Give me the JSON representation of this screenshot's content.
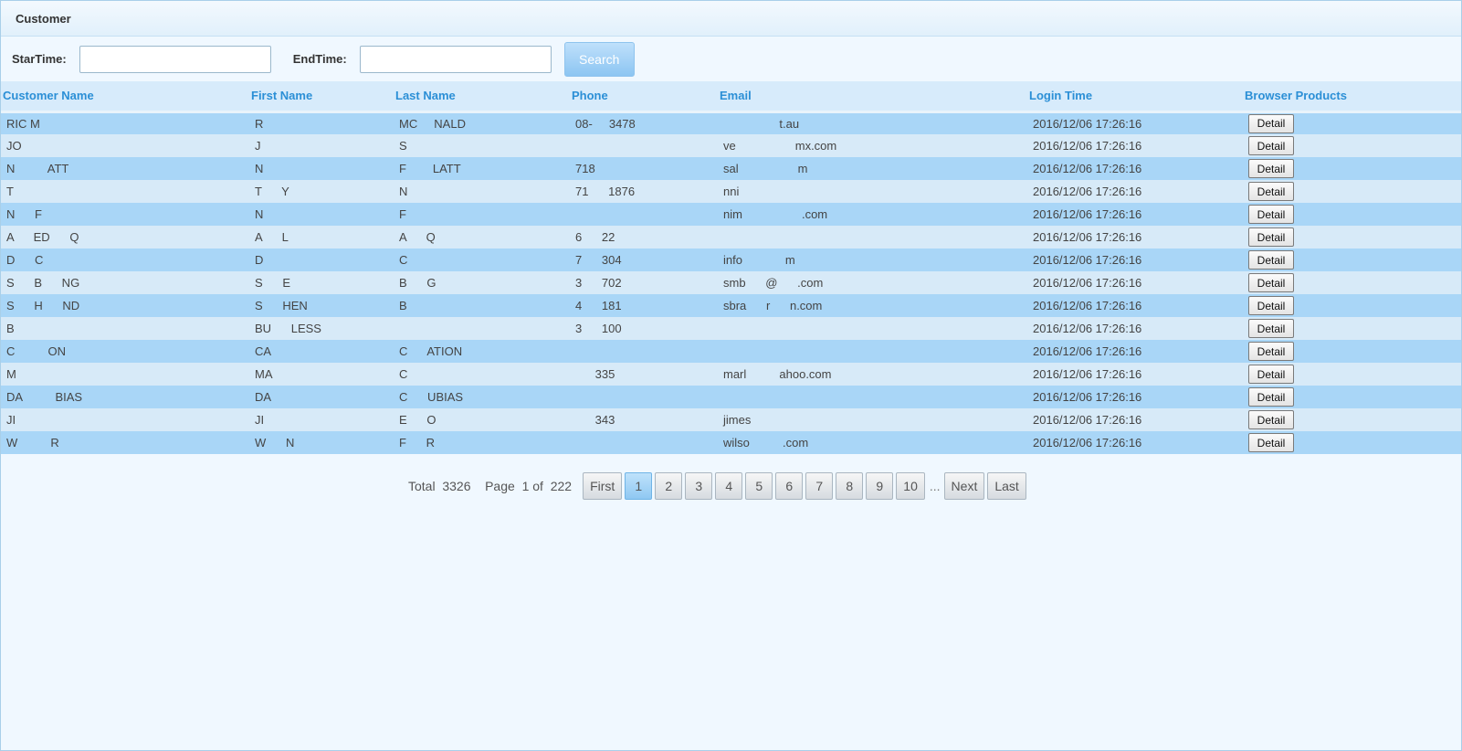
{
  "panel": {
    "title": "Customer"
  },
  "search": {
    "start_label": "StarTime:",
    "start_value": "",
    "end_label": "EndTime:",
    "end_value": "",
    "button_label": "Search"
  },
  "table": {
    "columns": [
      "Customer Name",
      "First Name",
      "Last Name",
      "Phone",
      "Email",
      "Login Time",
      "Browser Products"
    ],
    "detail_label": "Detail",
    "rows": [
      {
        "customer_name": "RIC M",
        "first_name": "R",
        "last_name": "MC     NALD",
        "phone": "08-     3478",
        "email": "                 t.au",
        "login_time": "2016/12/06 17:26:16"
      },
      {
        "customer_name": "JO",
        "first_name": "J",
        "last_name": "S",
        "phone": "",
        "email": "ve                  mx.com",
        "login_time": "2016/12/06 17:26:16"
      },
      {
        "customer_name": "N          ATT",
        "first_name": "N",
        "last_name": "F        LATT",
        "phone": "718",
        "email": "sal                  m",
        "login_time": "2016/12/06 17:26:16"
      },
      {
        "customer_name": "T",
        "first_name": "T      Y",
        "last_name": "N",
        "phone": "71      1876",
        "email": "nni",
        "login_time": "2016/12/06 17:26:16"
      },
      {
        "customer_name": "N      F",
        "first_name": "N",
        "last_name": "F",
        "phone": "",
        "email": "nim                  .com",
        "login_time": "2016/12/06 17:26:16"
      },
      {
        "customer_name": "A      ED      Q",
        "first_name": "A      L",
        "last_name": "A      Q",
        "phone": "6      22",
        "email": "",
        "login_time": "2016/12/06 17:26:16"
      },
      {
        "customer_name": "D      C",
        "first_name": "D",
        "last_name": "C",
        "phone": "7      304",
        "email": "info             m",
        "login_time": "2016/12/06 17:26:16"
      },
      {
        "customer_name": "S      B      NG",
        "first_name": "S      E",
        "last_name": "B      G",
        "phone": "3      702",
        "email": "smb      @      .com",
        "login_time": "2016/12/06 17:26:16"
      },
      {
        "customer_name": "S      H      ND",
        "first_name": "S      HEN",
        "last_name": "B",
        "phone": "4      181",
        "email": "sbra      r      n.com",
        "login_time": "2016/12/06 17:26:16"
      },
      {
        "customer_name": "B",
        "first_name": "BU      LESS",
        "last_name": "",
        "phone": "3      100",
        "email": "",
        "login_time": "2016/12/06 17:26:16"
      },
      {
        "customer_name": "C          ON",
        "first_name": "CA",
        "last_name": "C      ATION",
        "phone": "",
        "email": "",
        "login_time": "2016/12/06 17:26:16"
      },
      {
        "customer_name": "M",
        "first_name": "MA",
        "last_name": "C",
        "phone": "      335",
        "email": "marl          ahoo.com",
        "login_time": "2016/12/06 17:26:16"
      },
      {
        "customer_name": "DA          BIAS",
        "first_name": "DA",
        "last_name": "C      UBIAS",
        "phone": "",
        "email": "",
        "login_time": "2016/12/06 17:26:16"
      },
      {
        "customer_name": "JI",
        "first_name": "JI",
        "last_name": "E      O",
        "phone": "      343",
        "email": "jimes",
        "login_time": "2016/12/06 17:26:16"
      },
      {
        "customer_name": "W          R",
        "first_name": "W      N",
        "last_name": "F      R",
        "phone": "",
        "email": "wilso          .com",
        "login_time": "2016/12/06 17:26:16"
      }
    ]
  },
  "pager": {
    "total_label": "Total",
    "total": "3326",
    "page_label": "Page",
    "current": "1",
    "of_label": "of",
    "pages": "222",
    "first": "First",
    "numbers": [
      "1",
      "2",
      "3",
      "4",
      "5",
      "6",
      "7",
      "8",
      "9",
      "10"
    ],
    "ellipsis": "...",
    "next": "Next",
    "last": "Last"
  }
}
